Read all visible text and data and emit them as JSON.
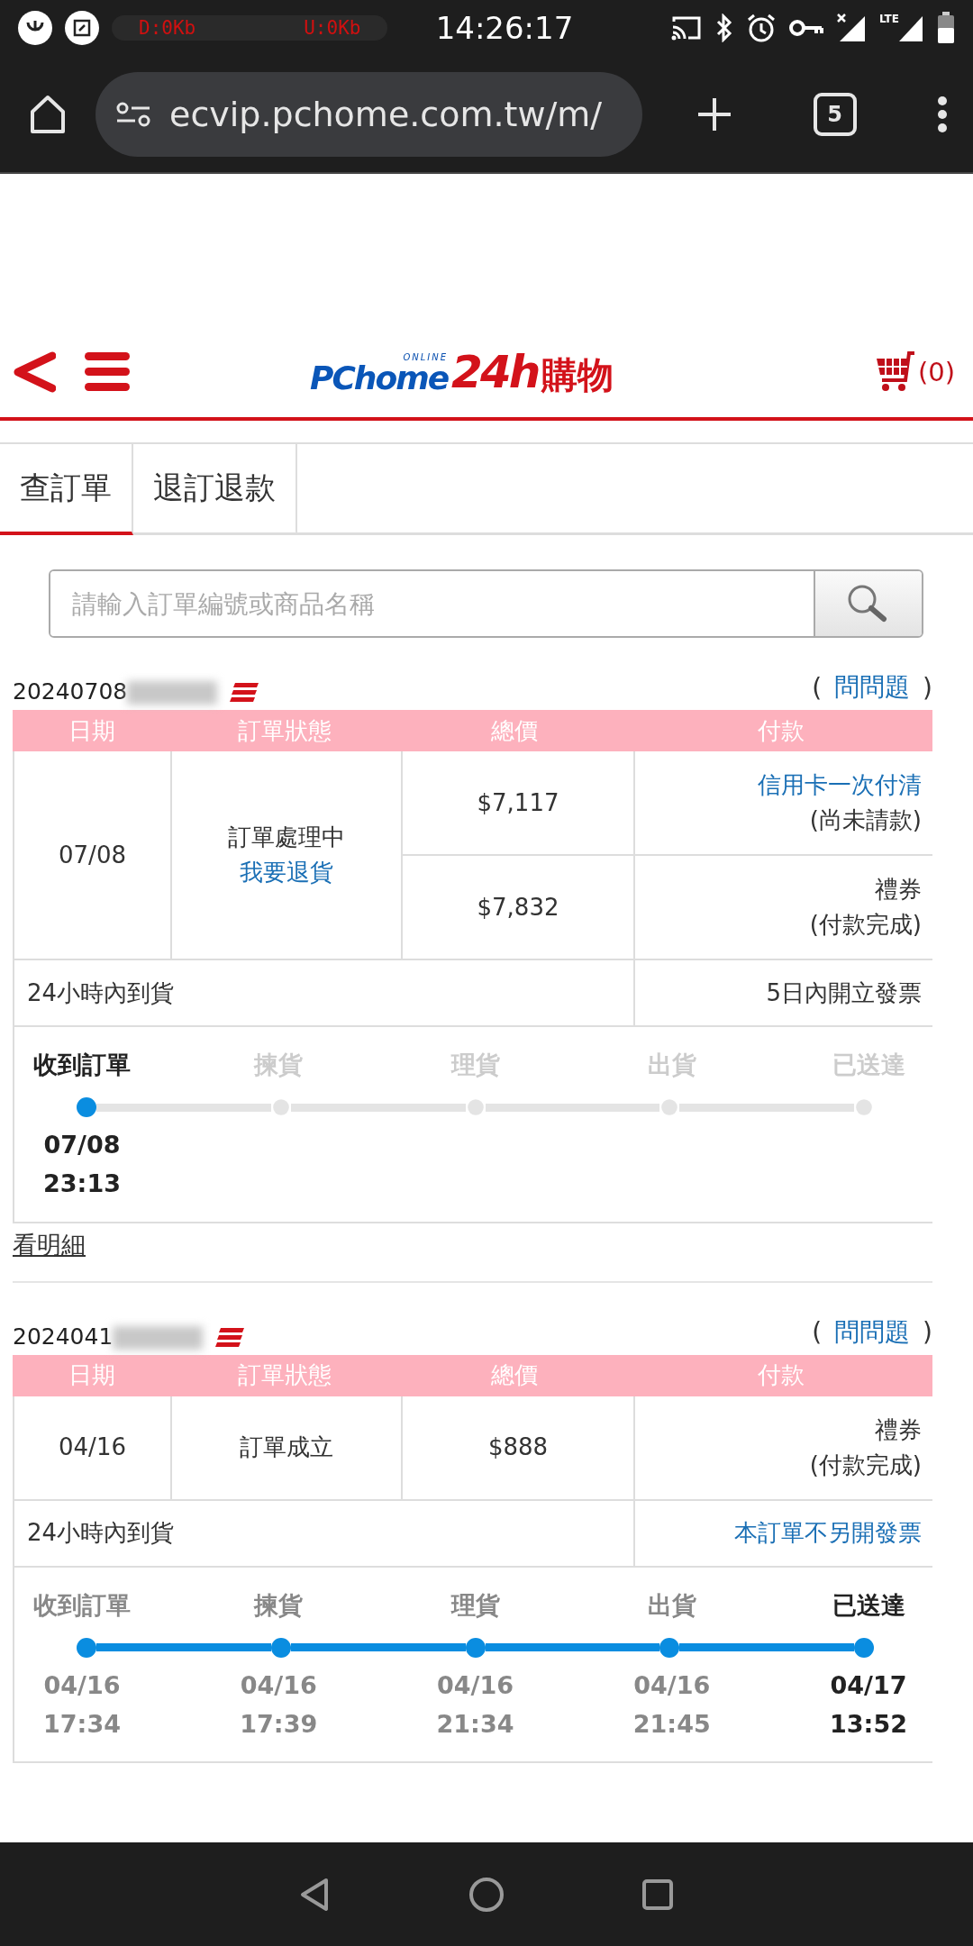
{
  "status_bar": {
    "net_down": "D:0Kb",
    "net_up": "U:0Kb",
    "time": "14:26:17",
    "network": "LTE"
  },
  "browser": {
    "url": "ecvip.pchome.com.tw/m/",
    "tab_count": "5"
  },
  "header": {
    "logo": {
      "tag": "ONLINE",
      "brand": "PChome",
      "hours": "24h",
      "shop": "購物"
    },
    "cart_count": "(0)"
  },
  "tabs": [
    {
      "label": "查訂單",
      "selected": true
    },
    {
      "label": "退訂退款",
      "selected": false
    }
  ],
  "search": {
    "placeholder": "請輸入訂單編號或商品名稱"
  },
  "orders": [
    {
      "number": "20240708",
      "ask_open": "(",
      "ask": "問問題",
      "ask_close": ")",
      "columns": [
        "日期",
        "訂單狀態",
        "總價",
        "付款"
      ],
      "date": "07/08",
      "status": "訂單處理中",
      "status_link": "我要退貨",
      "payments": [
        {
          "total": "$7,117",
          "method": "信用卡一次付清",
          "method_link": true,
          "state": "(尚未請款)"
        },
        {
          "total": "$7,832",
          "method": "禮券",
          "method_link": false,
          "state": "(付款完成)"
        }
      ],
      "delivery": "24小時內到貨",
      "invoice": "5日內開立發票",
      "invoice_link": false,
      "steps": [
        {
          "label": "收到訂單",
          "done": true,
          "current": true,
          "date": "07/08",
          "time": "23:13"
        },
        {
          "label": "揀貨",
          "done": false,
          "current": false
        },
        {
          "label": "理貨",
          "done": false,
          "current": false
        },
        {
          "label": "出貨",
          "done": false,
          "current": false
        },
        {
          "label": "已送達",
          "done": false,
          "current": false
        }
      ],
      "details": "看明細"
    },
    {
      "number": "2024041",
      "ask_open": "(",
      "ask": "問問題",
      "ask_close": ")",
      "columns": [
        "日期",
        "訂單狀態",
        "總價",
        "付款"
      ],
      "date": "04/16",
      "status": "訂單成立",
      "payments": [
        {
          "total": "$888",
          "method": "禮券",
          "method_link": false,
          "state": "(付款完成)"
        }
      ],
      "delivery": "24小時內到貨",
      "invoice": "本訂單不另開發票",
      "invoice_link": true,
      "steps": [
        {
          "label": "收到訂單",
          "done": true,
          "current": false,
          "date": "04/16",
          "time": "17:34"
        },
        {
          "label": "揀貨",
          "done": true,
          "current": false,
          "date": "04/16",
          "time": "17:39"
        },
        {
          "label": "理貨",
          "done": true,
          "current": false,
          "date": "04/16",
          "time": "21:34"
        },
        {
          "label": "出貨",
          "done": true,
          "current": false,
          "date": "04/16",
          "time": "21:45"
        },
        {
          "label": "已送達",
          "done": true,
          "current": true,
          "date": "04/17",
          "time": "13:52"
        }
      ]
    }
  ]
}
